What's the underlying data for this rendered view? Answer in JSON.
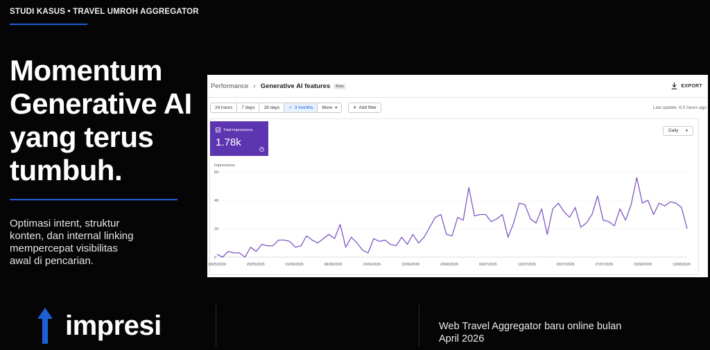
{
  "slide": {
    "eyebrow": "STUDI KASUS • TRAVEL UMROH AGGREGATOR",
    "headline": [
      "Momentum",
      "Generative AI",
      "yang terus",
      "tumbuh."
    ],
    "subcopy": [
      "Optimasi intent, struktur",
      "konten, dan internal linking",
      "mempercepat visibilitas",
      "awal di pencarian."
    ],
    "metric_label": "impresi",
    "note": [
      "Web Travel Aggregator baru online bulan",
      "April 2026"
    ],
    "colors": {
      "accent": "#1d5fd6",
      "background": "#050506",
      "metric_card": "#5e35b1",
      "series": "#7e57c2"
    }
  },
  "console": {
    "breadcrumb_root": "Performance",
    "breadcrumb_separator": "›",
    "breadcrumb_current": "Generative AI features",
    "beta_badge": "Beta",
    "export_label": "EXPORT",
    "date_ranges": [
      "24 hours",
      "7 days",
      "28 days",
      "3 months",
      "More"
    ],
    "active_range": "3 months",
    "add_filter_label": "Add filter",
    "last_update": "Last update: 6.5 hours ago",
    "metric_title": "Total impressions",
    "metric_value": "1.78k",
    "granularity": "Daily"
  },
  "chart_data": {
    "type": "line",
    "ylabel": "Impressions",
    "ylim": [
      0,
      60
    ],
    "yticks": [
      0,
      20,
      40,
      60
    ],
    "x_ticks": [
      "18/05/2026",
      "25/05/2026",
      "01/06/2026",
      "08/06/2026",
      "15/06/2026",
      "22/06/2026",
      "29/06/2026",
      "06/07/2026",
      "13/07/2026",
      "20/07/2026",
      "27/07/2026",
      "03/08/2026",
      "10/08/2026"
    ],
    "x_start": "18/05/2026",
    "x_end": "11/08/2026",
    "grid": true,
    "series": [
      {
        "values": [
          2,
          0,
          4,
          3,
          3,
          0,
          7,
          4,
          9,
          8,
          8,
          12,
          12,
          11,
          7,
          8,
          15,
          12,
          10,
          13,
          16,
          13,
          23,
          7,
          14,
          10,
          5,
          3,
          13,
          11,
          12,
          9,
          8,
          14,
          9,
          16,
          10,
          14,
          21,
          28,
          30,
          16,
          15,
          28,
          26,
          49,
          29,
          30,
          30,
          25,
          27,
          30,
          14,
          24,
          38,
          37,
          27,
          24,
          34,
          16,
          34,
          38,
          32,
          28,
          35,
          21,
          24,
          30,
          43,
          26,
          25,
          22,
          34,
          26,
          37,
          56,
          38,
          40,
          30,
          38,
          36,
          39,
          38,
          35,
          20
        ]
      }
    ]
  }
}
